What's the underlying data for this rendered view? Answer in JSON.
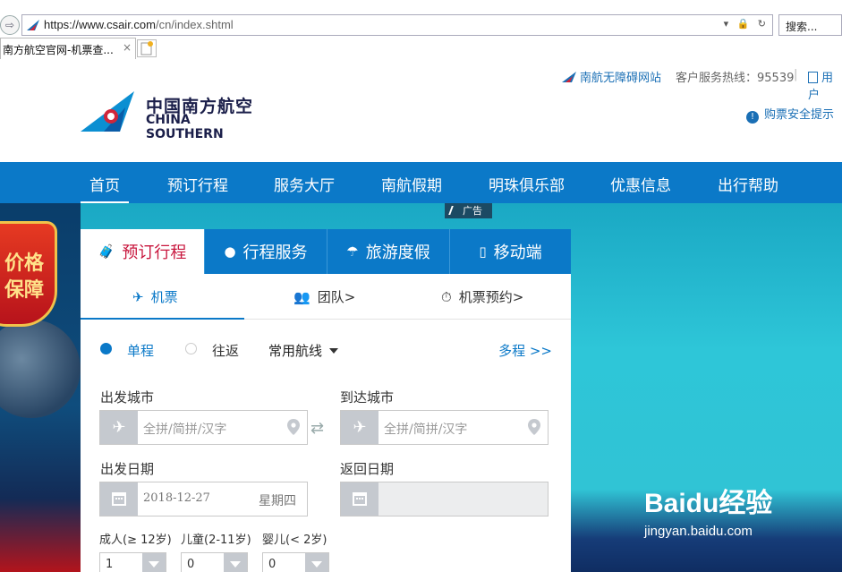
{
  "browser": {
    "url_prefix": "https://www.",
    "url_domain": "csair.com",
    "url_path": "/cn/index.shtml",
    "url_controls": "▾ 🔒 ↻",
    "search_placeholder": "搜索...",
    "tab_title": "南方航空官网-机票查...",
    "tab_close": "×"
  },
  "header": {
    "accessibility_link": "南航无障碍网站",
    "hotline": "客户服务热线：95539",
    "user_link": "用户",
    "safety_tip": "购票安全提示",
    "logo_cn": "中国南方航空",
    "logo_en": "CHINA SOUTHERN"
  },
  "nav": {
    "items": [
      "首页",
      "预订行程",
      "服务大厅",
      "南航假期",
      "明珠俱乐部",
      "优惠信息",
      "出行帮助"
    ]
  },
  "hero": {
    "ad_label": "广告",
    "badge_line1": "价格",
    "badge_line2": "保障",
    "watermark_main": "Baidu经验",
    "watermark_sub": "jingyan.baidu.com"
  },
  "booking": {
    "tabs": [
      "预订行程",
      "行程服务",
      "旅游度假",
      "移动端"
    ],
    "subtabs": [
      "机票",
      "团队>",
      "机票预约>"
    ],
    "trip_oneway": "单程",
    "trip_return": "往返",
    "routes": "常用航线",
    "multi": "多程 >>",
    "depart_city_label": "出发城市",
    "arrive_city_label": "到达城市",
    "city_placeholder": "全拼/简拼/汉字",
    "depart_date_label": "出发日期",
    "return_date_label": "返回日期",
    "depart_date": "2018-12-27",
    "depart_weekday": "星期四",
    "adult_label": "成人(≥ 12岁)",
    "child_label": "儿童(2-11岁)",
    "infant_label": "婴儿(< 2岁)",
    "adult_count": "1",
    "child_count": "0",
    "infant_count": "0"
  },
  "colors": {
    "brand_blue": "#0b79c8",
    "active_red": "#c8163d"
  }
}
